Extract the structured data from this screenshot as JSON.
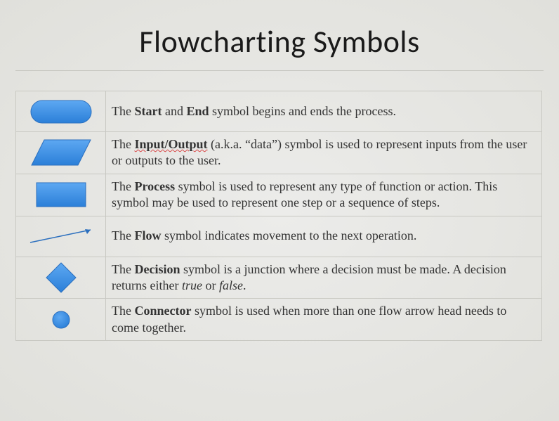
{
  "title": "Flowcharting Symbols",
  "rows": {
    "start_end": {
      "pre": "The ",
      "bold1": "Start",
      "mid": " and ",
      "bold2": "End",
      "post": " symbol begins and ends the process."
    },
    "io": {
      "pre": "The ",
      "bold": "Input/Output",
      "post": " (a.k.a. “data”) symbol is used to represent inputs from the user or outputs to the user."
    },
    "process": {
      "pre": "The ",
      "bold": "Process",
      "post": " symbol is used to represent any type of function or action. This symbol may be used to represent one step or a sequence of steps."
    },
    "flow": {
      "pre": "The ",
      "bold": "Flow",
      "post": " symbol indicates movement to the next operation."
    },
    "decision": {
      "pre": "The ",
      "bold": "Decision",
      "post1": " symbol is a junction where a decision must be made. A decision returns either ",
      "ital1": "true",
      "mid": " or ",
      "ital2": "false",
      "post2": "."
    },
    "connector": {
      "pre": "The ",
      "bold": "Connector",
      "post": " symbol is used when more than one flow arrow head needs to come together."
    }
  }
}
